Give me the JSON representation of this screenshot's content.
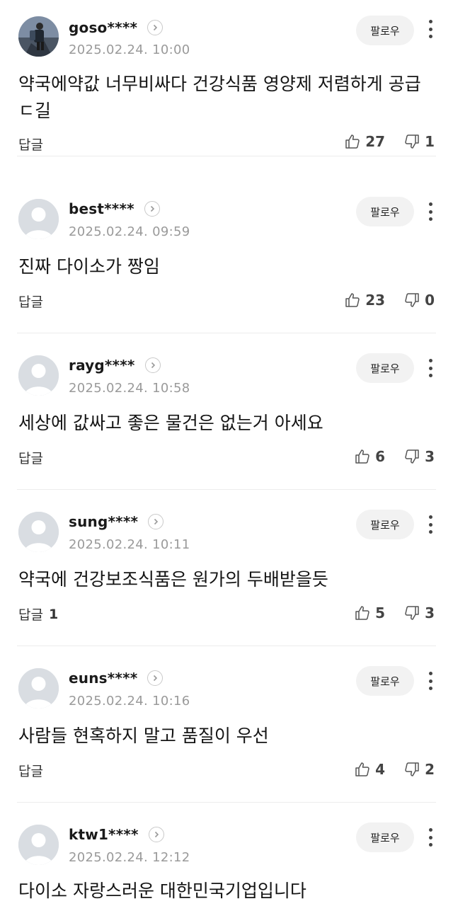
{
  "follow_label": "팔로우",
  "reply_label": "답글",
  "comments": [
    {
      "username": "goso****",
      "date": "2025.02.24. 10:00",
      "text": "약국에약값 너무비싸다 건강식품 영양제 저렴하게 공급ㄷ길",
      "reply_count": "",
      "likes": "27",
      "dislikes": "1",
      "avatar": "photo"
    },
    {
      "username": "best****",
      "date": "2025.02.24. 09:59",
      "text": "진짜 다이소가 짱임",
      "reply_count": "",
      "likes": "23",
      "dislikes": "0",
      "avatar": "default"
    },
    {
      "username": "rayg****",
      "date": "2025.02.24. 10:58",
      "text": "세상에 값싸고 좋은 물건은 없는거 아세요",
      "reply_count": "",
      "likes": "6",
      "dislikes": "3",
      "avatar": "default"
    },
    {
      "username": "sung****",
      "date": "2025.02.24. 10:11",
      "text": "약국에 건강보조식품은 원가의 두배받을듯",
      "reply_count": "1",
      "likes": "5",
      "dislikes": "3",
      "avatar": "default"
    },
    {
      "username": "euns****",
      "date": "2025.02.24. 10:16",
      "text": "사람들 현혹하지 말고 품질이 우선",
      "reply_count": "",
      "likes": "4",
      "dislikes": "2",
      "avatar": "default"
    },
    {
      "username": "ktw1****",
      "date": "2025.02.24. 12:12",
      "text": "다이소 자랑스러운 대한민국기업입니다",
      "reply_count": "",
      "likes": "",
      "dislikes": "",
      "avatar": "default"
    }
  ]
}
